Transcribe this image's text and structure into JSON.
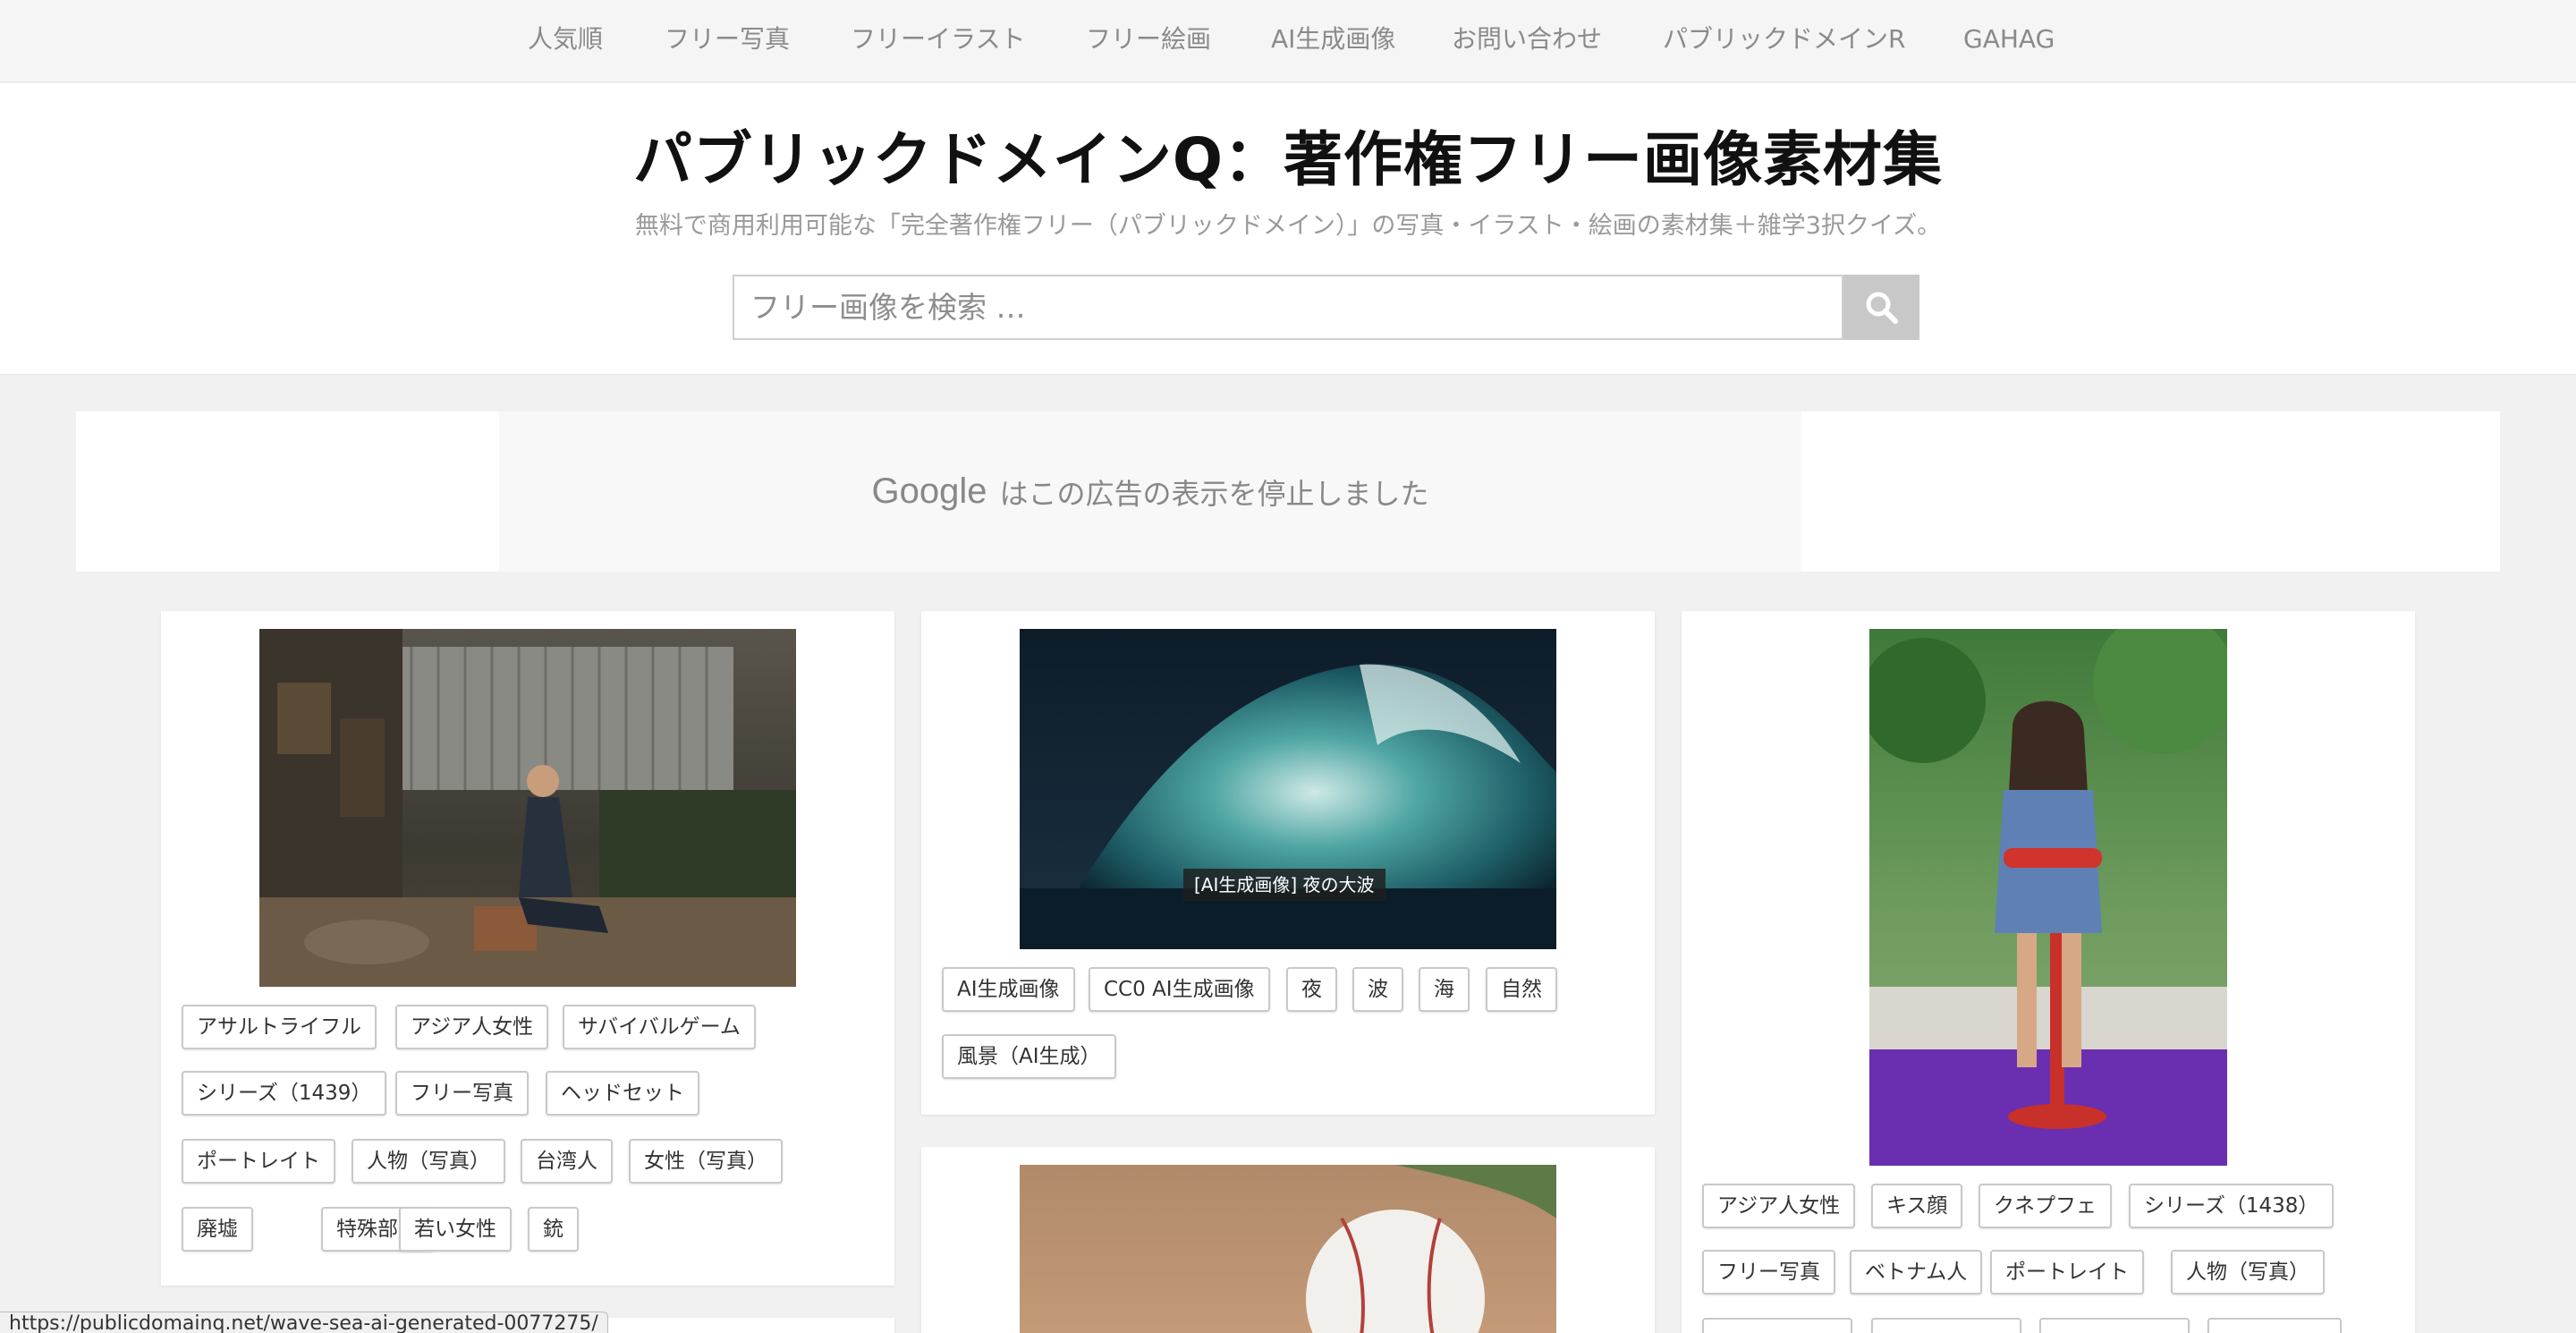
{
  "nav": {
    "items": [
      "人気順",
      "フリー写真",
      "フリーイラスト",
      "フリー絵画",
      "AI生成画像",
      "お問い合わせ",
      "パブリックドメインR",
      "GAHAG"
    ]
  },
  "header": {
    "title": "パブリックドメインQ：著作権フリー画像素材集",
    "description": "無料で商用利用可能な「完全著作権フリー（パブリックドメイン）」の写真・イラスト・絵画の素材集＋雑学3択クイズ。",
    "search_placeholder": "フリー画像を検索 …"
  },
  "ad": {
    "google": "Google",
    "message": "はこの広告の表示を停止しました"
  },
  "cards": {
    "left": {
      "image_alt": "廃墟で銃を持つアジア人女性のポートレート",
      "tags": [
        "アサルトライフル",
        "アジア人女性",
        "サバイバルゲーム",
        "シリーズ（1439）",
        "フリー写真",
        "ヘッドセット",
        "ポートレイト",
        "人物（写真）",
        "台湾人",
        "女性（写真）",
        "廃墟",
        "特殊部隊",
        "若い女性",
        "銃"
      ]
    },
    "middle": {
      "caption": "[AI生成画像] 夜の大波",
      "tags": [
        "AI生成画像",
        "CC0 AI生成画像",
        "夜",
        "波",
        "海",
        "自然",
        "風景（AI生成）"
      ]
    },
    "right": {
      "tags": [
        "アジア人女性",
        "キス顔",
        "クネプフェ",
        "シリーズ（1438）",
        "フリー写真",
        "ベトナム人",
        "ポートレイト",
        "人物（写真）"
      ]
    }
  },
  "status_url": "https://publicdomainq.net/wave-sea-ai-generated-0077275/",
  "colors": {
    "nav_bg": "#f5f5f5",
    "page_bg": "#f1f1f1",
    "title": "#111111",
    "search_button": "#c8c8c8"
  }
}
